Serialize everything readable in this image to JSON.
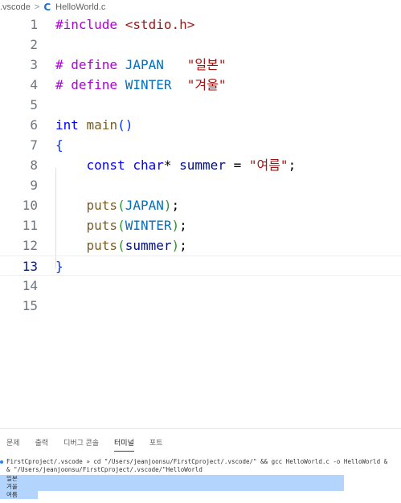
{
  "breadcrumb": {
    "folder": ".vscode",
    "separator": ">",
    "file_icon": "C",
    "file": "HelloWorld.c"
  },
  "editor": {
    "current_line": 13,
    "lines": [
      {
        "n": "1",
        "tokens": [
          {
            "t": "#include",
            "c": "#af00db"
          },
          {
            "t": " "
          },
          {
            "t": "<stdio.h>",
            "c": "#a31515"
          }
        ]
      },
      {
        "n": "2",
        "tokens": []
      },
      {
        "n": "3",
        "tokens": [
          {
            "t": "# define ",
            "c": "#af00db"
          },
          {
            "t": "JAPAN",
            "c": "#0070c1"
          },
          {
            "t": "   "
          },
          {
            "t": "\"일본\"",
            "c": "#a31515"
          }
        ]
      },
      {
        "n": "4",
        "tokens": [
          {
            "t": "# define ",
            "c": "#af00db"
          },
          {
            "t": "WINTER",
            "c": "#0070c1"
          },
          {
            "t": "  "
          },
          {
            "t": "\"겨울\"",
            "c": "#a31515"
          }
        ]
      },
      {
        "n": "5",
        "tokens": []
      },
      {
        "n": "6",
        "tokens": [
          {
            "t": "int",
            "c": "#0000ff"
          },
          {
            "t": " "
          },
          {
            "t": "main",
            "c": "#795e26"
          },
          {
            "t": "()",
            "c": "#0431fa"
          }
        ]
      },
      {
        "n": "7",
        "tokens": [
          {
            "t": "{",
            "c": "#0431fa"
          }
        ]
      },
      {
        "n": "8",
        "tokens": [
          {
            "t": "    "
          },
          {
            "t": "const",
            "c": "#0000ff"
          },
          {
            "t": " "
          },
          {
            "t": "char",
            "c": "#0000ff"
          },
          {
            "t": "*",
            "c": "#000000"
          },
          {
            "t": " summer",
            "c": "#001080"
          },
          {
            "t": " = "
          },
          {
            "t": "\"여름\"",
            "c": "#a31515"
          },
          {
            "t": ";"
          }
        ]
      },
      {
        "n": "9",
        "tokens": []
      },
      {
        "n": "10",
        "tokens": [
          {
            "t": "    "
          },
          {
            "t": "puts",
            "c": "#795e26"
          },
          {
            "t": "(",
            "c": "#319331"
          },
          {
            "t": "JAPAN",
            "c": "#0070c1"
          },
          {
            "t": ")",
            "c": "#319331"
          },
          {
            "t": ";"
          }
        ]
      },
      {
        "n": "11",
        "tokens": [
          {
            "t": "    "
          },
          {
            "t": "puts",
            "c": "#795e26"
          },
          {
            "t": "(",
            "c": "#319331"
          },
          {
            "t": "WINTER",
            "c": "#0070c1"
          },
          {
            "t": ")",
            "c": "#319331"
          },
          {
            "t": ";"
          }
        ]
      },
      {
        "n": "12",
        "tokens": [
          {
            "t": "    "
          },
          {
            "t": "puts",
            "c": "#795e26"
          },
          {
            "t": "(",
            "c": "#319331"
          },
          {
            "t": "summer",
            "c": "#001080"
          },
          {
            "t": ")",
            "c": "#319331"
          },
          {
            "t": ";"
          }
        ]
      },
      {
        "n": "13",
        "tokens": [
          {
            "t": "}",
            "c": "#0431fa"
          }
        ]
      },
      {
        "n": "14",
        "tokens": []
      },
      {
        "n": "15",
        "tokens": []
      }
    ]
  },
  "panel": {
    "tabs": [
      {
        "label": "문제",
        "active": false
      },
      {
        "label": "출력",
        "active": false
      },
      {
        "label": "디버그 콘솔",
        "active": false
      },
      {
        "label": "터미널",
        "active": true
      },
      {
        "label": "포트",
        "active": false
      }
    ]
  },
  "terminal": {
    "command_line_1": "FirstCproject/.vscode » cd \"/Users/jeanjoonsu/FirstCproject/.vscode/\" && gcc HelloWorld.c -o HelloWorld &",
    "command_line_2": "& \"/Users/jeanjoonsu/FirstCproject/.vscode/\"HelloWorld",
    "output": [
      "일본",
      "겨울",
      "여름"
    ]
  },
  "colors": {
    "accent": "#1e6fd9",
    "selection": "#b3d4fc",
    "line_number": "#6e7681",
    "line_number_active": "#0b216f"
  }
}
